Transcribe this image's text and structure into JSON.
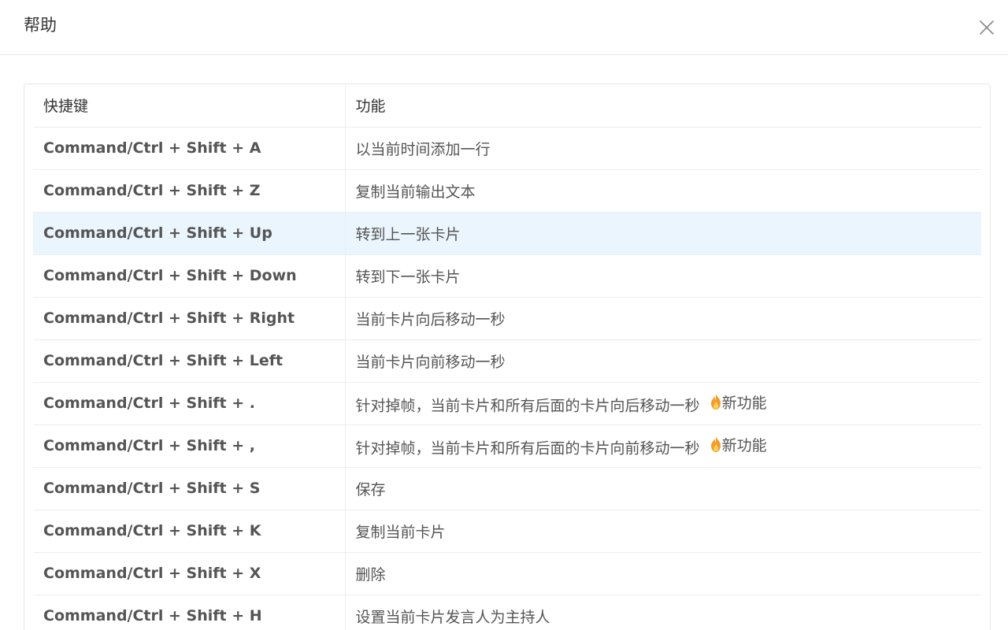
{
  "dialog": {
    "title": "帮助",
    "close_icon": "close-icon"
  },
  "table": {
    "headers": {
      "shortcut": "快捷键",
      "function": "功能"
    },
    "rows": [
      {
        "shortcut": "Command/Ctrl + Shift + A",
        "function": "以当前时间添加一行",
        "badge": ""
      },
      {
        "shortcut": "Command/Ctrl + Shift + Z",
        "function": "复制当前输出文本",
        "badge": ""
      },
      {
        "shortcut": "Command/Ctrl + Shift + Up",
        "function": "转到上一张卡片",
        "badge": ""
      },
      {
        "shortcut": "Command/Ctrl + Shift + Down",
        "function": "转到下一张卡片",
        "badge": ""
      },
      {
        "shortcut": "Command/Ctrl + Shift + Right",
        "function": "当前卡片向后移动一秒",
        "badge": ""
      },
      {
        "shortcut": "Command/Ctrl + Shift + Left",
        "function": "当前卡片向前移动一秒",
        "badge": ""
      },
      {
        "shortcut": "Command/Ctrl + Shift + .",
        "function": "针对掉帧，当前卡片和所有后面的卡片向后移动一秒",
        "badge": "新功能"
      },
      {
        "shortcut": "Command/Ctrl + Shift + ,",
        "function": "针对掉帧，当前卡片和所有后面的卡片向前移动一秒",
        "badge": "新功能"
      },
      {
        "shortcut": "Command/Ctrl + Shift + S",
        "function": "保存",
        "badge": ""
      },
      {
        "shortcut": "Command/Ctrl + Shift + K",
        "function": "复制当前卡片",
        "badge": ""
      },
      {
        "shortcut": "Command/Ctrl + Shift + X",
        "function": "删除",
        "badge": ""
      },
      {
        "shortcut": "Command/Ctrl + Shift + H",
        "function": "设置当前卡片发言人为主持人",
        "badge": ""
      }
    ]
  },
  "icons": {
    "new_feature_icon": "flame-icon"
  },
  "colors": {
    "highlight_row": "#eaf5fd",
    "flame": "#f39c2b"
  }
}
